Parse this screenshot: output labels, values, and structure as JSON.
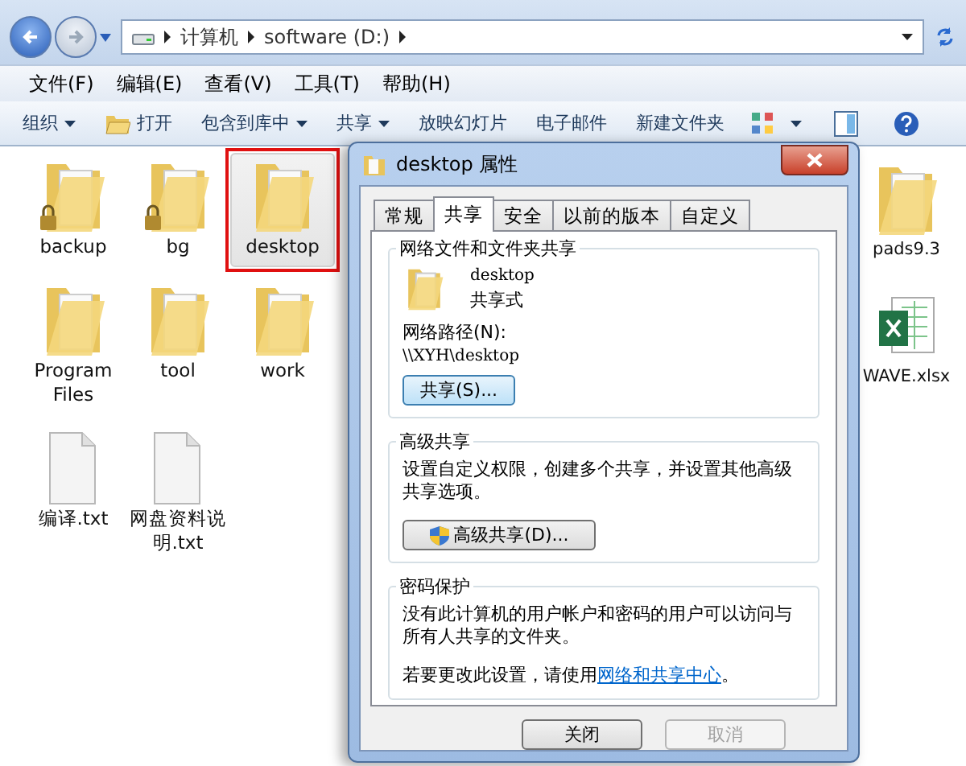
{
  "address_bar": {
    "path": [
      "计算机",
      "software (D:)"
    ]
  },
  "menu_bar": [
    "文件(F)",
    "编辑(E)",
    "查看(V)",
    "工具(T)",
    "帮助(H)"
  ],
  "toolbar": [
    {
      "label": "组织",
      "kind": "menu"
    },
    {
      "label": "打开",
      "kind": "open"
    },
    {
      "label": "包含到库中",
      "kind": "menu"
    },
    {
      "label": "共享",
      "kind": "menu"
    },
    {
      "label": "放映幻灯片",
      "kind": "plain"
    },
    {
      "label": "电子邮件",
      "kind": "plain"
    },
    {
      "label": "新建文件夹",
      "kind": "plain"
    }
  ],
  "files": [
    {
      "name": "backup",
      "kind": "locked-folder",
      "selected": false,
      "annotated": false
    },
    {
      "name": "bg",
      "kind": "locked-folder",
      "selected": false,
      "annotated": false
    },
    {
      "name": "desktop",
      "kind": "folder",
      "selected": true,
      "annotated": true
    },
    {
      "name": "Program Files",
      "kind": "folder",
      "selected": false,
      "annotated": false
    },
    {
      "name": "tool",
      "kind": "folder",
      "selected": false,
      "annotated": false
    },
    {
      "name": "work",
      "kind": "folder",
      "selected": false,
      "annotated": false
    },
    {
      "name": "编译.txt",
      "kind": "text",
      "selected": false,
      "annotated": false
    },
    {
      "name": "网盘资料说明.txt",
      "kind": "text",
      "selected": false,
      "annotated": false
    }
  ],
  "right_files": [
    {
      "name": "pads9.3",
      "kind": "folder",
      "selected": false,
      "annotated": false
    },
    {
      "name": "WAVE.xlsx",
      "kind": "spreadsheet",
      "selected": false,
      "annotated": false
    }
  ],
  "dialog": {
    "title": "desktop 属性",
    "tabs": [
      {
        "label": "常规",
        "selected": false
      },
      {
        "label": "共享",
        "selected": true
      },
      {
        "label": "安全",
        "selected": false
      },
      {
        "label": "以前的版本",
        "selected": false
      },
      {
        "label": "自定义",
        "selected": false
      }
    ],
    "network_sharing": {
      "heading": "网络文件和文件夹共享",
      "folder_name": "desktop",
      "status": "共享式",
      "path_label": "网络路径(N):",
      "path": "\\\\XYH\\desktop",
      "button": "共享(S)..."
    },
    "advanced_sharing": {
      "heading": "高级共享",
      "description": "设置自定义权限，创建多个共享，并设置其他高级共享选项。",
      "button": "高级共享(D)..."
    },
    "password_protection": {
      "heading": "密码保护",
      "description": "没有此计算机的用户帐户和密码的用户可以访问与所有人共享的文件夹。",
      "change_text": "若要更改此设置，请使用",
      "link": "网络和共享中心",
      "change_end": "。"
    },
    "buttons": [
      {
        "label": "关闭",
        "disabled": false
      },
      {
        "label": "取消",
        "disabled": true
      }
    ]
  }
}
